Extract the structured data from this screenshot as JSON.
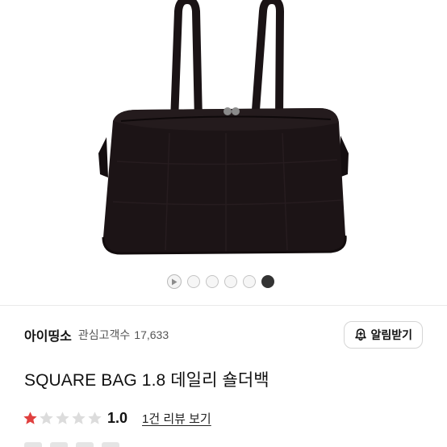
{
  "product": {
    "image_alt": "black square shoulder bag",
    "carousel": {
      "total_slides": 5,
      "active_index": 5,
      "has_video": true
    },
    "shop": {
      "name": "아이띵소",
      "follower_label": "관심고객수",
      "follower_count": "17,633",
      "alarm_button_label": "알림받기"
    },
    "title": "SQUARE BAG 1.8 데일리 숄더백",
    "rating": {
      "score": "1.0",
      "stars_filled": 1,
      "stars_total": 5,
      "review_link": "1건 리뷰 보기"
    }
  },
  "colors": {
    "star_filled": "#e0403f",
    "star_empty": "#dcdcdc",
    "bag": "#1c1416"
  }
}
